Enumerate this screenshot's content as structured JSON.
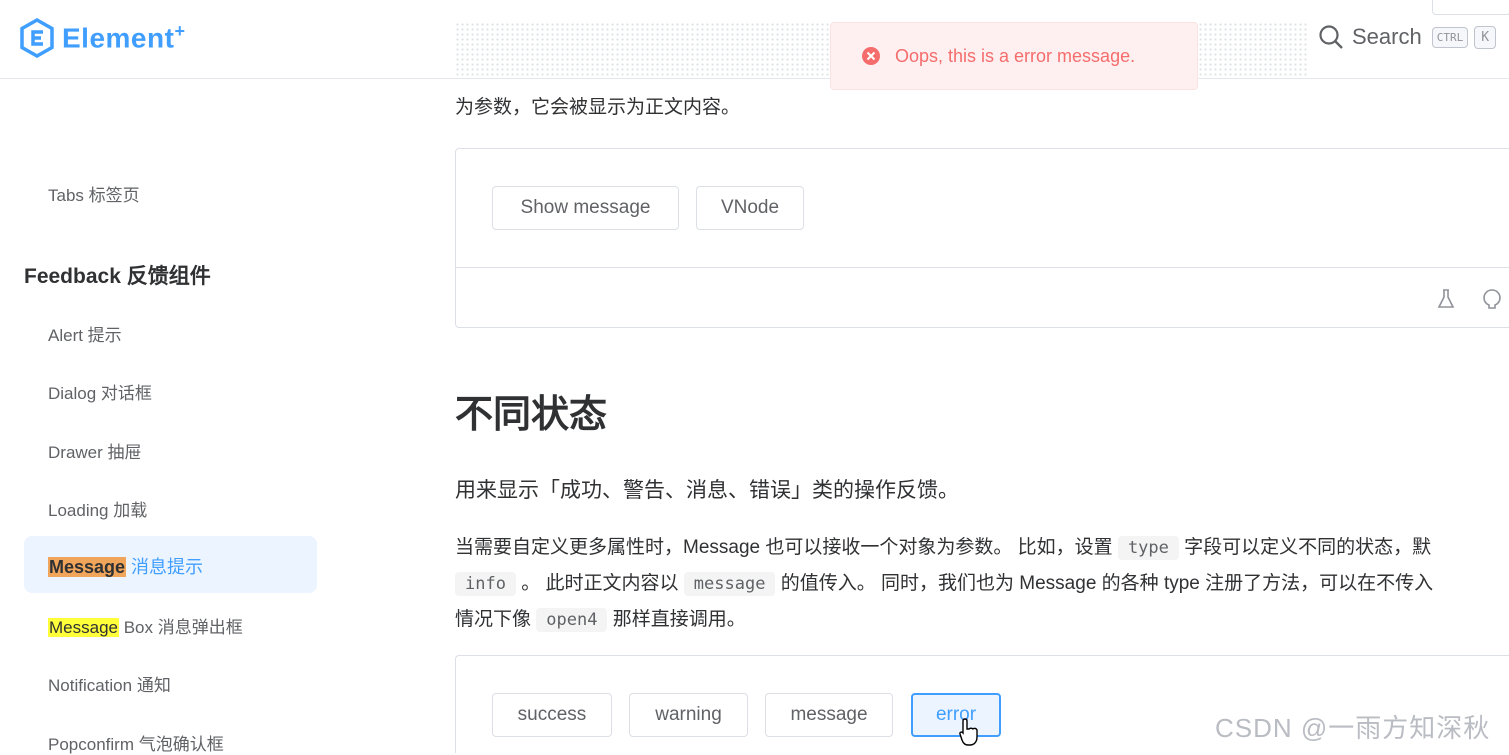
{
  "header": {
    "logo_text": "Element",
    "logo_plus": "+",
    "search_label": "Search",
    "kbd_ctrl": "CTRL",
    "kbd_k": "K"
  },
  "toast": {
    "text": "Oops, this is a error message.",
    "color": "#f56c6c"
  },
  "sidebar": {
    "items_before": [
      {
        "label": "Tabs 标签页"
      }
    ],
    "group_title": "Feedback 反馈组件",
    "items": [
      {
        "label": "Alert 提示"
      },
      {
        "label": "Dialog 对话框"
      },
      {
        "label": "Drawer 抽屉"
      },
      {
        "label": "Loading 加载"
      }
    ],
    "active": {
      "highlight": "Message",
      "rest": " 消息提示"
    },
    "message_box": {
      "highlight": "Message",
      "rest": " Box 消息弹出框"
    },
    "items_after": [
      {
        "label": "Notification 通知"
      },
      {
        "label": "Popconfirm 气泡确认框"
      }
    ]
  },
  "main": {
    "top_text": "为参数，它会被显示为正文内容。",
    "demo1": {
      "buttons": [
        "Show message",
        "VNode"
      ]
    },
    "section_title": "不同状态",
    "para1": "用来显示「成功、警告、消息、错误」类的操作反馈。",
    "para2": {
      "line1_a": "当需要自定义更多属性时，Message 也可以接收一个对象为参数。 比如，设置",
      "code_type": "type",
      "line1_b": "字段可以定义不同的状态，默",
      "code_info": "info",
      "line2_a": "。 此时正文内容以",
      "code_message": "message",
      "line2_b": "的值传入。 同时，我们也为 Message 的各种 type 注册了方法，可以在不传入",
      "line3_a": "情况下像",
      "code_open4": "open4",
      "line3_b": "那样直接调用。"
    },
    "demo2": {
      "buttons": [
        "success",
        "warning",
        "message",
        "error"
      ]
    }
  },
  "watermark": "CSDN @一雨方知深秋",
  "colors": {
    "primary": "#409eff",
    "error": "#f56c6c",
    "text": "#303133"
  }
}
